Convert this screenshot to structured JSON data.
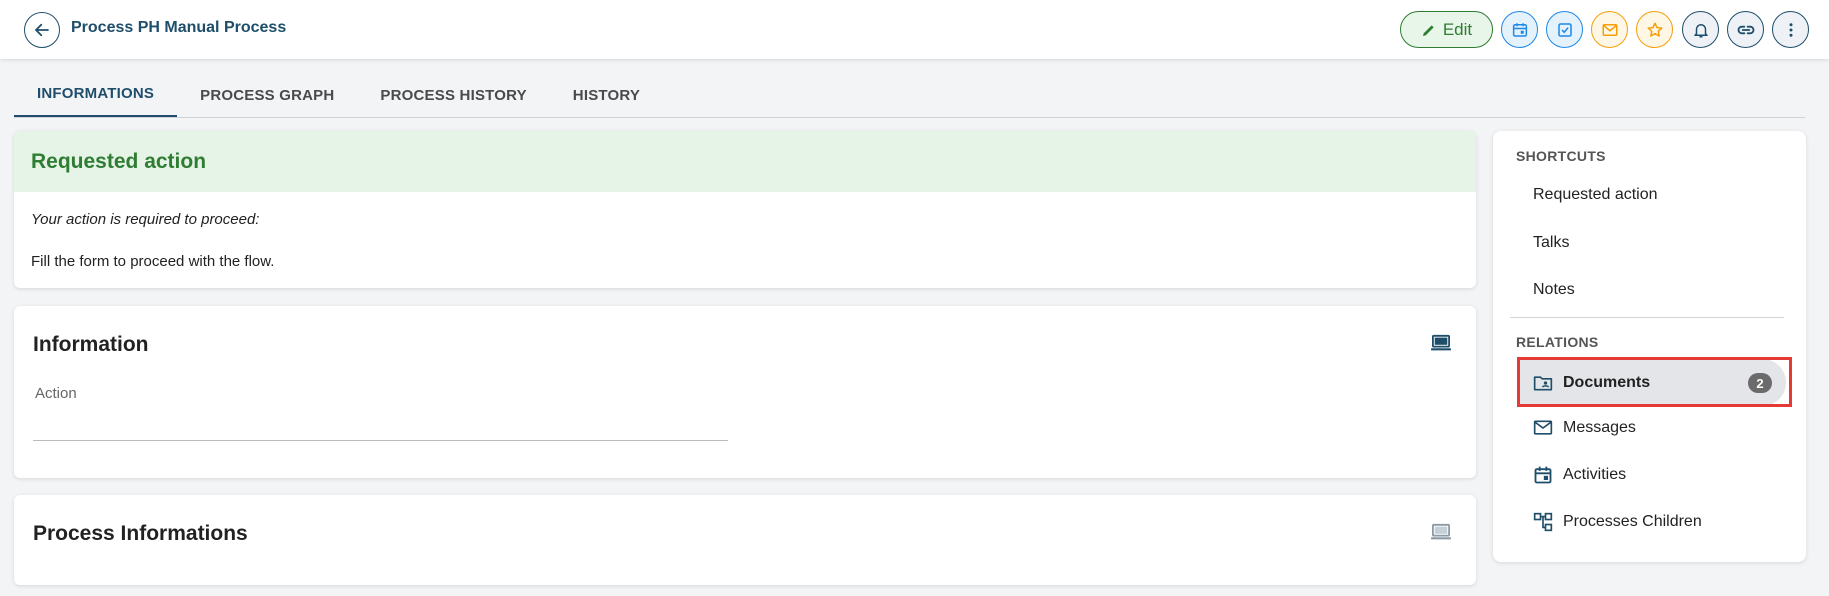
{
  "header": {
    "title": "Process PH Manual Process",
    "edit_label": "Edit",
    "actions": [
      "calendar-icon",
      "checkbox-icon",
      "mail-icon",
      "star-icon",
      "bell-icon",
      "link-icon",
      "more-vertical-icon"
    ]
  },
  "tabs": [
    {
      "label": "INFORMATIONS",
      "active": true
    },
    {
      "label": "PROCESS GRAPH",
      "active": false
    },
    {
      "label": "PROCESS HISTORY",
      "active": false
    },
    {
      "label": "HISTORY",
      "active": false
    }
  ],
  "requested": {
    "title": "Requested action",
    "subtitle": "Your action is required to proceed:",
    "text": "Fill the form to proceed with the flow."
  },
  "information": {
    "title": "Information",
    "field_label": "Action"
  },
  "process_info": {
    "title": "Process Informations"
  },
  "sidebar": {
    "shortcuts_label": "SHORTCUTS",
    "shortcuts": [
      "Requested action",
      "Talks",
      "Notes"
    ],
    "relations_label": "RELATIONS",
    "relations": [
      {
        "label": "Documents",
        "icon": "folder-account-icon",
        "badge": "2",
        "active": true
      },
      {
        "label": "Messages",
        "icon": "mail-icon"
      },
      {
        "label": "Activities",
        "icon": "calendar-icon"
      },
      {
        "label": "Processes Children",
        "icon": "hierarchy-icon"
      }
    ]
  },
  "colors": {
    "primary": "#1f4e6b",
    "success": "#2e7d32",
    "success_bg": "#e6f4e8",
    "accent_blue": "#1e88e5",
    "accent_orange": "#f59e0b",
    "highlight": "#e53935"
  }
}
